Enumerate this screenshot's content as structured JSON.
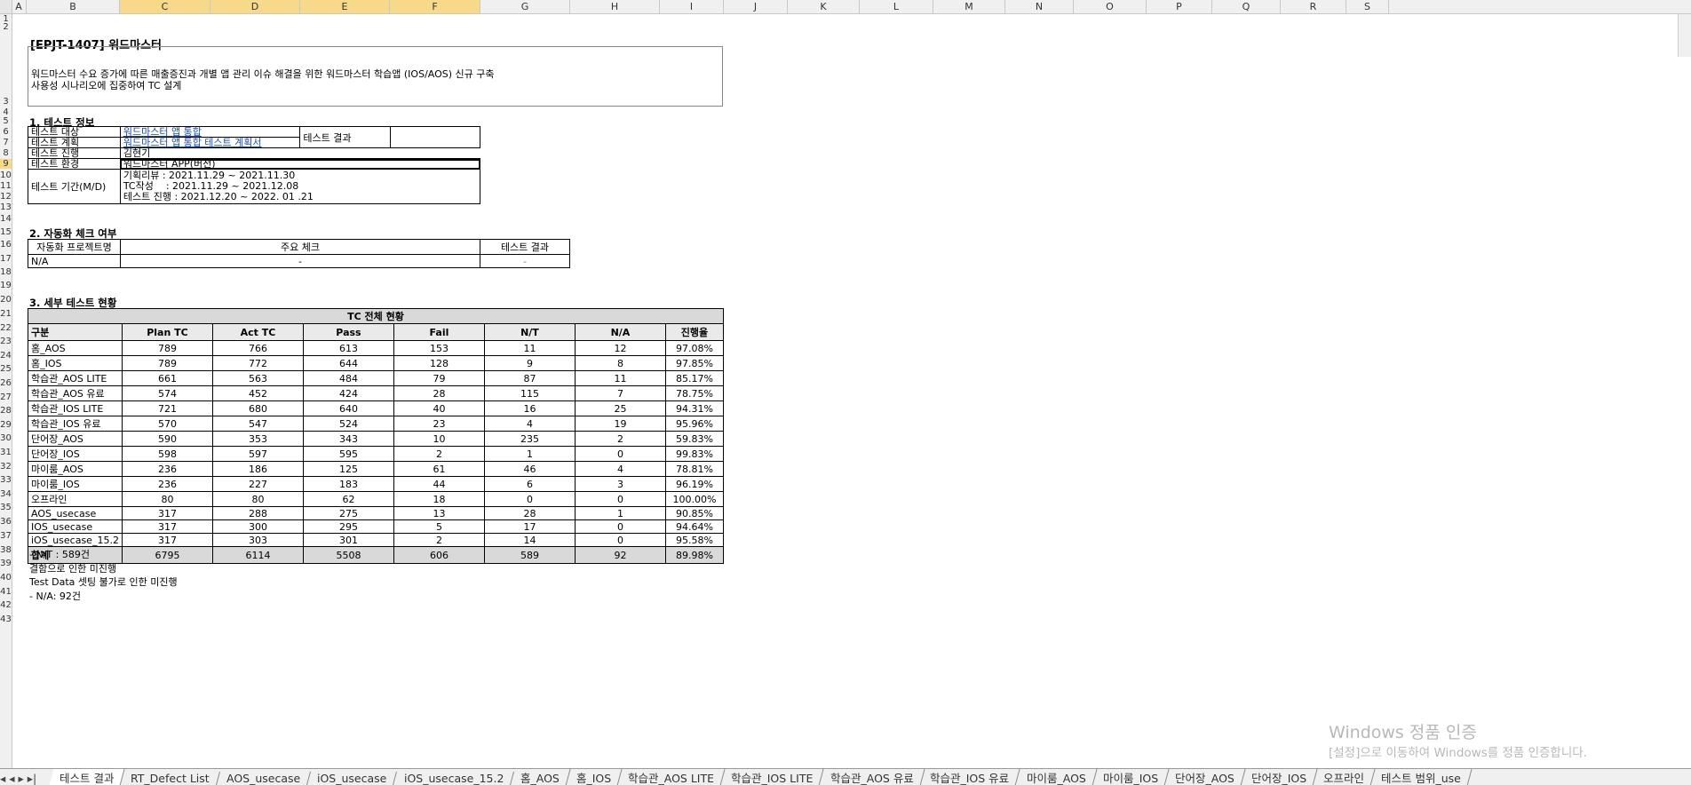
{
  "columns": [
    "A",
    "B",
    "C",
    "D",
    "E",
    "F",
    "G",
    "H",
    "I",
    "J",
    "K",
    "L",
    "M",
    "N",
    "O",
    "P",
    "Q",
    "R",
    "S"
  ],
  "rows": [
    "1",
    "2",
    "3",
    "4",
    "5",
    "6",
    "7",
    "8",
    "9",
    "10",
    "11",
    "12",
    "13",
    "14",
    "15",
    "16",
    "17",
    "18",
    "19",
    "20",
    "21",
    "22",
    "23",
    "24",
    "25",
    "26",
    "27",
    "28",
    "29",
    "30",
    "31",
    "32",
    "33",
    "34",
    "35",
    "36",
    "37",
    "38",
    "39",
    "40",
    "41",
    "42",
    "43"
  ],
  "doc": {
    "title": "[EPJT-1407] 워드마스터",
    "description_line1": "워드마스터 수요 증가에 따른 매출증진과 개별 앱 관리 이슈 해결을 위한 워드마스터 학습앱 (IOS/AOS) 신규 구축",
    "description_line2": "사용성 시나리오에 집중하여 TC 설계"
  },
  "section1": {
    "heading": "1. 테스트 정보",
    "target_label": "테스트 대상",
    "target_value": "워드마스터 앱 통합",
    "plan_label": "테스트 계획",
    "plan_value": "워드마스터 앱 통합 테스트 계획서",
    "result_label": "테스트 결과",
    "progress_label": "테스트 진행",
    "progress_value": "김현기",
    "env_label": "테스트 환경",
    "env_value": "워드마스터 APP(버전)",
    "period_label": "테스트 기간(M/D)",
    "period_line1": "기획리뷰 : 2021.11.29 ~ 2021.11.30",
    "period_line2": "TC작성    : 2021.11.29 ~ 2021.12.08",
    "period_line3": "테스트 진행 : 2021.12.20 ~ 2022. 01 .21"
  },
  "section2": {
    "heading": "2. 자동화 체크 여부",
    "col1": "자동화 프로젝트명",
    "col2": "주요 체크",
    "col3": "테스트 결과",
    "val1": "N/A",
    "val2": "-",
    "val3": "-"
  },
  "section3": {
    "heading": "3. 세부 테스트 현황",
    "table_title": "TC 전체 현황",
    "headers": [
      "구분",
      "Plan TC",
      "Act TC",
      "Pass",
      "Fail",
      "N/T",
      "N/A",
      "진행율"
    ],
    "rows": [
      [
        "홈_AOS",
        "789",
        "766",
        "613",
        "153",
        "11",
        "12",
        "97.08%"
      ],
      [
        "홈_IOS",
        "789",
        "772",
        "644",
        "128",
        "9",
        "8",
        "97.85%"
      ],
      [
        "학습관_AOS LITE",
        "661",
        "563",
        "484",
        "79",
        "87",
        "11",
        "85.17%"
      ],
      [
        "학습관_AOS 유료",
        "574",
        "452",
        "424",
        "28",
        "115",
        "7",
        "78.75%"
      ],
      [
        "학습관_IOS LITE",
        "721",
        "680",
        "640",
        "40",
        "16",
        "25",
        "94.31%"
      ],
      [
        "학습관_IOS 유료",
        "570",
        "547",
        "524",
        "23",
        "4",
        "19",
        "95.96%"
      ],
      [
        "단어장_AOS",
        "590",
        "353",
        "343",
        "10",
        "235",
        "2",
        "59.83%"
      ],
      [
        "단어장_IOS",
        "598",
        "597",
        "595",
        "2",
        "1",
        "0",
        "99.83%"
      ],
      [
        "마이룸_AOS",
        "236",
        "186",
        "125",
        "61",
        "46",
        "4",
        "78.81%"
      ],
      [
        "마이룸_IOS",
        "236",
        "227",
        "183",
        "44",
        "6",
        "3",
        "96.19%"
      ],
      [
        "오프라인",
        "80",
        "80",
        "62",
        "18",
        "0",
        "0",
        "100.00%"
      ],
      [
        "AOS_usecase",
        "317",
        "288",
        "275",
        "13",
        "28",
        "1",
        "90.85%"
      ],
      [
        "IOS_usecase",
        "317",
        "300",
        "295",
        "5",
        "17",
        "0",
        "94.64%"
      ],
      [
        "iOS_usecase_15.2",
        "317",
        "303",
        "301",
        "2",
        "14",
        "0",
        "95.58%"
      ]
    ],
    "total": [
      "합계",
      "6795",
      "6114",
      "5508",
      "606",
      "589",
      "92",
      "89.98%"
    ],
    "note1": "- N/T : 589건",
    "note2": "결함으로 인한 미진행",
    "note3": "Test Data 셋팅 불가로 인한 미진행",
    "note4": "- N/A: 92건"
  },
  "sheet_tabs": [
    "테스트 결과",
    "RT_Defect List",
    "AOS_usecase",
    "iOS_usecase",
    "iOS_usecase_15.2",
    "홈_AOS",
    "홈_IOS",
    "학습관_AOS LITE",
    "학습관_IOS LITE",
    "학습관_AOS 유료",
    "학습관_IOS 유료",
    "마이룸_AOS",
    "마이룸_IOS",
    "단어장_AOS",
    "단어장_IOS",
    "오프라인",
    "테스트 범위_use"
  ],
  "watermark": {
    "line1": "Windows 정품 인증",
    "line2": "[설정]으로 이동하여 Windows를 정품 인증합니다."
  }
}
